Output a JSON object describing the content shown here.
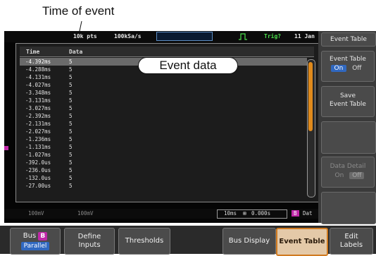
{
  "annotations": {
    "time_of_event": "Time of event",
    "event_data": "Event data"
  },
  "status_bar": {
    "points": "10k pts",
    "sample_rate": "100kSa/s",
    "trig": "Trig?",
    "date": "11 Jan"
  },
  "table": {
    "headers": [
      "Time",
      "Data"
    ],
    "rows": [
      {
        "time": "-4.392ms",
        "data": "5"
      },
      {
        "time": "-4.288ms",
        "data": "5"
      },
      {
        "time": "-4.131ms",
        "data": "5"
      },
      {
        "time": "-4.027ms",
        "data": "5"
      },
      {
        "time": "-3.348ms",
        "data": "5"
      },
      {
        "time": "-3.131ms",
        "data": "5"
      },
      {
        "time": "-3.027ms",
        "data": "5"
      },
      {
        "time": "-2.392ms",
        "data": "5"
      },
      {
        "time": "-2.131ms",
        "data": "5"
      },
      {
        "time": "-2.027ms",
        "data": "5"
      },
      {
        "time": "-1.236ms",
        "data": "5"
      },
      {
        "time": "-1.131ms",
        "data": "5"
      },
      {
        "time": "-1.027ms",
        "data": "5"
      },
      {
        "time": "-392.0us",
        "data": "5"
      },
      {
        "time": "-236.0us",
        "data": "5"
      },
      {
        "time": "-132.0us",
        "data": "5"
      },
      {
        "time": "-27.00us",
        "data": "5"
      }
    ],
    "scroll_position_fraction": 0.0
  },
  "sidebar": {
    "title": "Event Table",
    "event_table_label": "Event Table",
    "on": "On",
    "off": "Off",
    "save_label_1": "Save",
    "save_label_2": "Event Table",
    "data_detail_label": "Data Detail",
    "data_detail_on": "On",
    "data_detail_off": "Off"
  },
  "bottom_status": {
    "ch1": "100mV",
    "ch2": "100mV",
    "timebase": "10ms",
    "position": "0.000s",
    "bus_label": "B",
    "bus_text": "Dat"
  },
  "softkeys": {
    "bus": "Bus",
    "bus_badge": "B",
    "parallel": "Parallel",
    "define_1": "Define",
    "define_2": "Inputs",
    "thresholds": "Thresholds",
    "bus_display": "Bus Display",
    "event_table": "Event Table",
    "edit_1": "Edit",
    "edit_2": "Labels"
  },
  "colors": {
    "accent_blue": "#3068c0",
    "scroll_orange": "#e08a1c",
    "trig_green": "#4be04b",
    "bus_magenta": "#c028a8"
  }
}
